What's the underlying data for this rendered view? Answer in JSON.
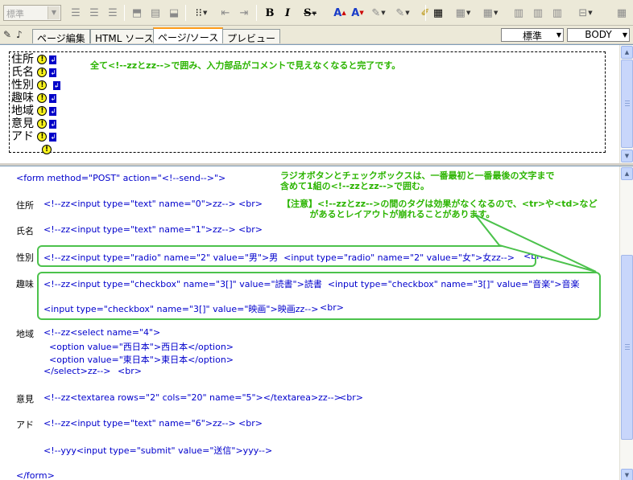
{
  "toolbar": {
    "style_select": "標準",
    "icons": [
      "align-left-icon",
      "align-center-icon",
      "align-right-icon",
      "insert-top-icon",
      "insert-middle-icon",
      "insert-bottom-icon",
      "list-icon",
      "outdent-icon",
      "indent-icon",
      "bold-icon",
      "italic-icon",
      "strikethrough-icon",
      "font-size-increase-icon",
      "font-size-decrease-icon",
      "font-color-icon",
      "highlight-icon",
      "table-icon",
      "table-insert-icon",
      "table-row-icon",
      "table-col-icon",
      "table-merge-icon",
      "table-split-icon",
      "align-grid-icon"
    ]
  },
  "tabs": [
    "ページ編集",
    "HTML ソース",
    "ページ/ソース",
    "プレビュー"
  ],
  "active_tab": "ページ/ソース",
  "right_selects": {
    "style": "標準",
    "tag": "BODY"
  },
  "design": {
    "fields": [
      "住所",
      "氏名",
      "性別",
      "趣味",
      "地域",
      "意見",
      "アド"
    ],
    "note": "全て<!--zzとzz-->で囲み、入力部品がコメントで見えなくなると完了です。"
  },
  "source": {
    "form_open": "<form method=\"POST\" action=\"<!--send-->\">",
    "rows": [
      {
        "label": "住所",
        "code": "<!--zz<input type=\"text\" name=\"0\">zz-->",
        "br": "<br>"
      },
      {
        "label": "氏名",
        "code": "<!--zz<input type=\"text\" name=\"1\">zz-->",
        "br": "<br>"
      },
      {
        "label": "性別",
        "code": "<!--zz<input type=\"radio\" name=\"2\" value=\"男\">男  <input type=\"radio\" name=\"2\" value=\"女\">女zz-->",
        "br": "<br>"
      },
      {
        "label": "趣味",
        "code": "<!--zz<input type=\"checkbox\" name=\"3[]\" value=\"読書\">読書  <input type=\"checkbox\" name=\"3[]\" value=\"音楽\">音楽",
        "br": ""
      },
      {
        "label": "",
        "code": "<input type=\"checkbox\" name=\"3[]\" value=\"映画\">映画zz-->",
        "br": "<br>"
      },
      {
        "label": "地域",
        "code": "<!--zz<select name=\"4\">",
        "br": ""
      },
      {
        "label": "",
        "code": "  <option value=\"西日本\">西日本</option>",
        "br": ""
      },
      {
        "label": "",
        "code": "  <option value=\"東日本\">東日本</option>",
        "br": ""
      },
      {
        "label": "",
        "code": "</select>zz-->",
        "br": "<br>"
      },
      {
        "label": "意見",
        "code": "<!--zz<textarea rows=\"2\" cols=\"20\" name=\"5\"></textarea>zz-->",
        "br": "<br>"
      },
      {
        "label": "アド",
        "code": "<!--zz<input type=\"text\" name=\"6\">zz-->",
        "br": "<br>"
      },
      {
        "label": "",
        "code": "<!--yyy<input type=\"submit\" value=\"送信\">yyy-->",
        "br": ""
      }
    ],
    "form_close": "</form>",
    "note1": "ラジオボタンとチェックボックスは、一番最初と一番最後の文字まで\n含めて1組の<!--zzとzz-->で囲む。",
    "note2": "【注意】<!--zzとzz-->の間のタグは効果がなくなるので、<tr>や<td>など\n         があるとレイアウトが崩れることがあります。"
  },
  "colors": {
    "note": "#2bb400",
    "box": "#4cc24c",
    "tag": "#0000cc",
    "tab_accent": "#ff9c1c"
  }
}
